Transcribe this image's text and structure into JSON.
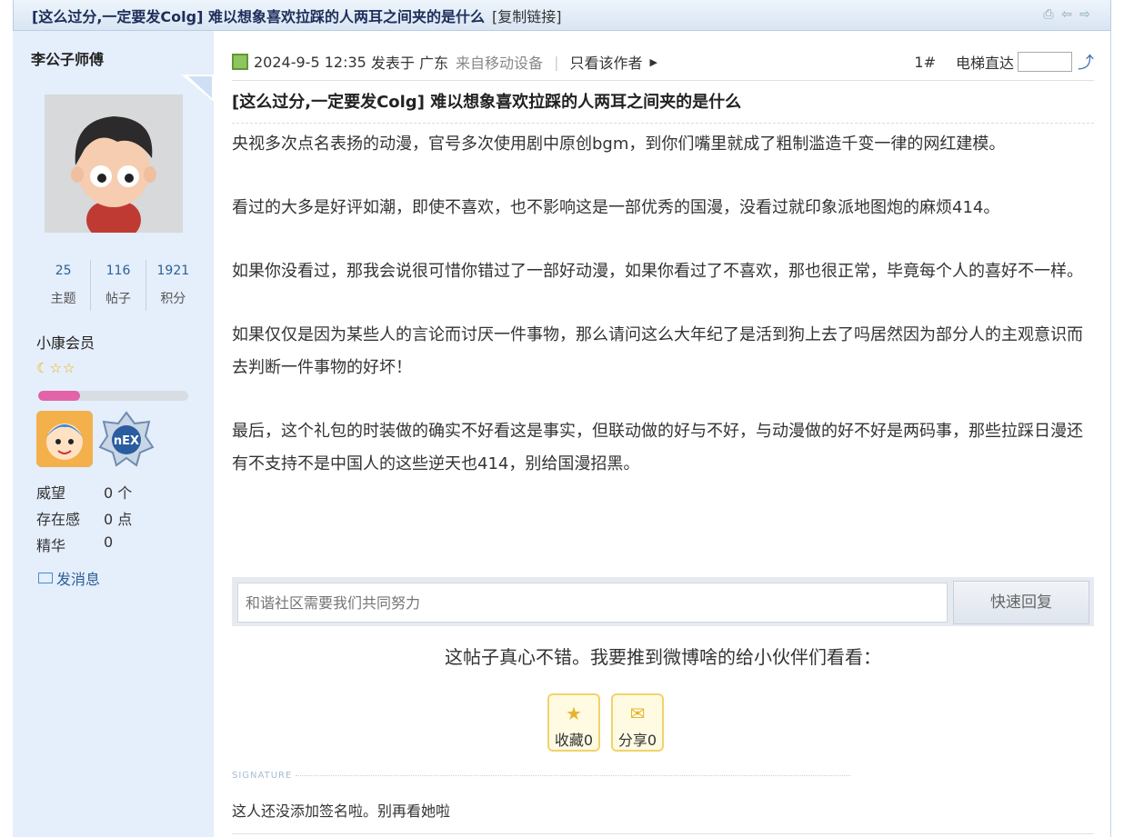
{
  "titlebar": {
    "title": "[这么过分,一定要发Colg] 难以想象喜欢拉踩的人两耳之间夹的是什么",
    "copy_link": "[复制链接]"
  },
  "user": {
    "name": "李公子师傅",
    "stats": [
      {
        "value": "25",
        "label": "主题"
      },
      {
        "value": "116",
        "label": "帖子"
      },
      {
        "value": "1921",
        "label": "积分"
      }
    ],
    "rank": "小康会员",
    "progress": 0.28,
    "info": [
      {
        "key": "威望",
        "value": "0 个"
      },
      {
        "key": "存在感",
        "value": "0 点"
      },
      {
        "key": "精华",
        "value": "0"
      }
    ],
    "send_message": "发消息"
  },
  "post": {
    "date": "2024-9-5 12:35",
    "posted_in": "发表于",
    "location": "广东",
    "device": "来自移动设备",
    "only_author": "只看该作者",
    "floor": "1#",
    "elevator": "电梯直达",
    "title": "[这么过分,一定要发Colg] 难以想象喜欢拉踩的人两耳之间夹的是什么",
    "paragraphs": [
      "央视多次点名表扬的动漫，官号多次使用剧中原创bgm，到你们嘴里就成了粗制滥造千变一律的网红建模。",
      "看过的大多是好评如潮，即使不喜欢，也不影响这是一部优秀的国漫，没看过就印象派地图炮的麻烦414。",
      "如果你没看过，那我会说很可惜你错过了一部好动漫，如果你看过了不喜欢，那也很正常，毕竟每个人的喜好不一样。",
      "如果仅仅是因为某些人的言论而讨厌一件事物，那么请问这么大年纪了是活到狗上去了吗居然因为部分人的主观意识而去判断一件事物的好坏！",
      "最后，这个礼包的时装做的确实不好看这是事实，但联动做的好与不好，与动漫做的好不好是两码事，那些拉踩日漫还有不支持不是中国人的这些逆天也414，别给国漫招黑。"
    ]
  },
  "reply": {
    "placeholder": "和谐社区需要我们共同努力",
    "button": "快速回复"
  },
  "share": {
    "prompt": "这帖子真心不错。我要推到微博啥的给小伙伴们看看：",
    "favorite": "收藏0",
    "share": "分享0"
  },
  "signature": {
    "label": "SIGNATURE",
    "text": "这人还没添加签名啦。别再看她啦"
  },
  "colors": {
    "accent": "#2a6296",
    "sidebar_bg": "#e5eefb",
    "progress_fill": "#e163a8"
  }
}
